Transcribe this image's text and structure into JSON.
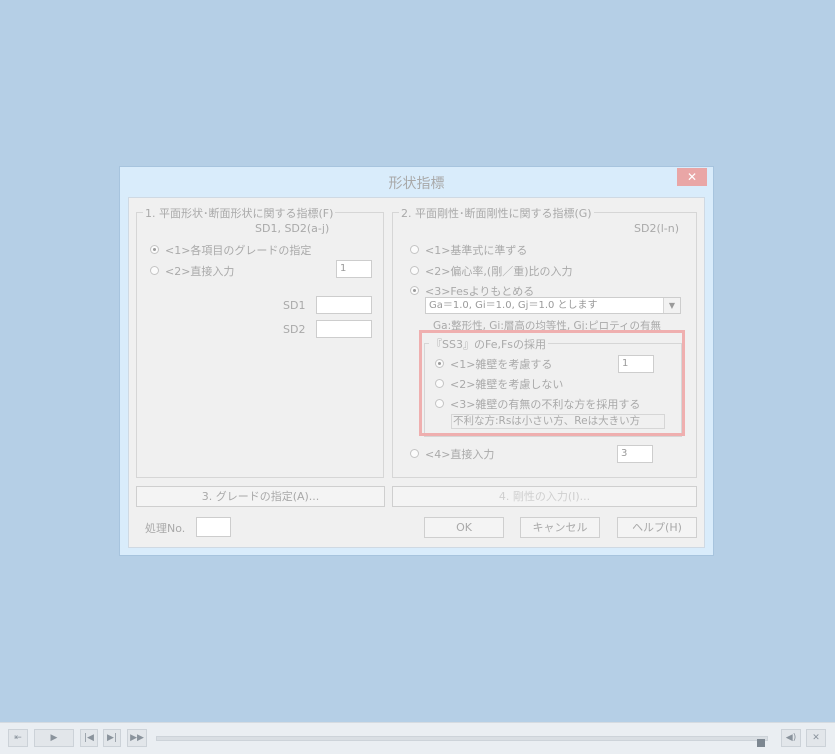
{
  "dialog": {
    "title": "形状指標",
    "close_glyph": "✕"
  },
  "left_group": {
    "legend": "1. 平面形状･断面形状に関する指標(F)",
    "subtitle": "SD1, SD2(a-j)",
    "radio1": "<1>各項目のグレードの指定",
    "radio2": "<2>直接入力",
    "value": "1",
    "sd1_label": "SD1",
    "sd2_label": "SD2",
    "sd1_value": "",
    "sd2_value": ""
  },
  "right_group": {
    "legend": "2. 平面剛性･断面剛性に関する指標(G)",
    "subtitle": "SD2(l-n)",
    "radio1": "<1>基準式に準ずる",
    "radio2": "<2>偏心率,(剛／重)比の入力",
    "radio3": "<3>Fesよりもとめる",
    "dropdown_value": "Ga＝1.0, Gi＝1.0, Gj＝1.0 とします",
    "note": "Ga:整形性, Gi:層高の均等性, Gj:ピロティの有無",
    "radio4": "<4>直接入力",
    "radio4_value": "3"
  },
  "inner_group": {
    "legend": "『SS3』のFe,Fsの採用",
    "radio1": "<1>雑壁を考慮する",
    "radio2": "<2>雑壁を考慮しない",
    "radio3": "<3>雑壁の有無の不利な方を採用する",
    "value": "1",
    "note": "不利な方:Rsは小さい方、Reは大きい方"
  },
  "buttons": {
    "grade": "3. グレードの指定(A)...",
    "rigidity": "4. 剛性の入力(I)...",
    "ok": "OK",
    "cancel": "キャンセル",
    "help": "ヘルプ(H)"
  },
  "process": {
    "label": "処理No.",
    "value": ""
  },
  "player": {
    "icons": [
      "exit-icon",
      "play-icon",
      "previous-icon",
      "next-icon",
      "fast-forward-icon",
      "volume-icon",
      "close-icon"
    ]
  }
}
